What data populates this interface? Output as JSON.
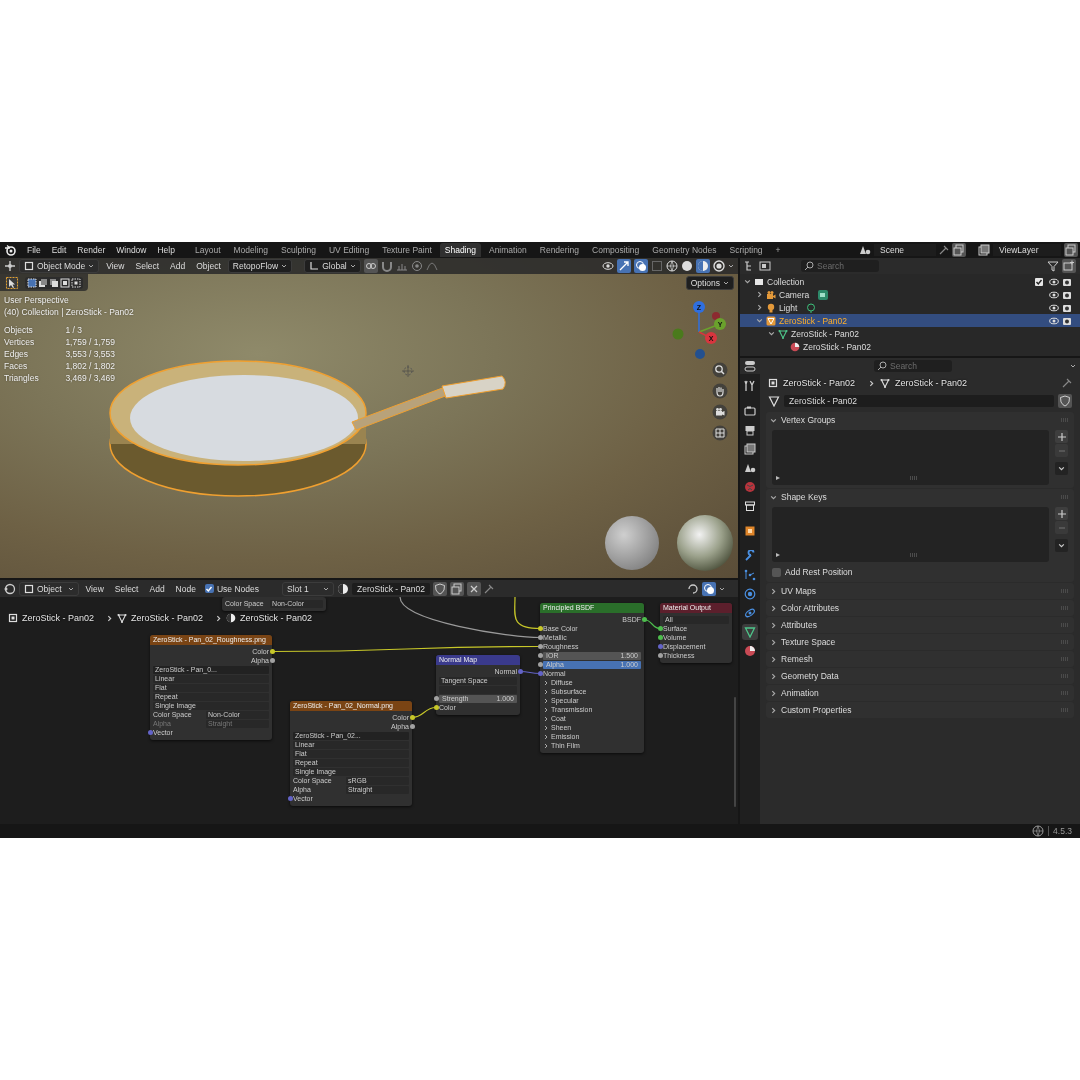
{
  "top_bar": {
    "menus": [
      "File",
      "Edit",
      "Render",
      "Window",
      "Help"
    ],
    "workspaces": [
      {
        "label": "Layout",
        "selected": false
      },
      {
        "label": "Modeling",
        "selected": false
      },
      {
        "label": "Sculpting",
        "selected": false
      },
      {
        "label": "UV Editing",
        "selected": false
      },
      {
        "label": "Texture Paint",
        "selected": false
      },
      {
        "label": "Shading",
        "selected": true
      },
      {
        "label": "Animation",
        "selected": false
      },
      {
        "label": "Rendering",
        "selected": false
      },
      {
        "label": "Compositing",
        "selected": false
      },
      {
        "label": "Geometry Nodes",
        "selected": false
      },
      {
        "label": "Scripting",
        "selected": false
      }
    ],
    "add_tab": "+",
    "scene": "Scene",
    "view_layer": "ViewLayer"
  },
  "viewport": {
    "mode": "Object Mode",
    "menus": [
      "View",
      "Select",
      "Add",
      "Object"
    ],
    "addon": "RetopoFlow",
    "orientation": "Global",
    "options": "Options",
    "view_name": "User Perspective",
    "collection": "(40) Collection | ZeroStick - Pan02",
    "stats": [
      {
        "label": "Objects",
        "value": "1 / 3"
      },
      {
        "label": "Vertices",
        "value": "1,759 / 1,759"
      },
      {
        "label": "Edges",
        "value": "3,553 / 3,553"
      },
      {
        "label": "Faces",
        "value": "1,802 / 1,802"
      },
      {
        "label": "Triangles",
        "value": "3,469 / 3,469"
      }
    ],
    "gizmo_axes": [
      "Z",
      "Y",
      "X"
    ]
  },
  "outliner": {
    "search_placeholder": "Search",
    "tree": [
      {
        "name": "Collection",
        "kind": "collection",
        "expanded": true,
        "selected": false,
        "checked": true,
        "children": [
          {
            "name": "Camera",
            "kind": "camera",
            "expanded": false,
            "selected": false
          },
          {
            "name": "Light",
            "kind": "light",
            "expanded": false,
            "selected": false
          },
          {
            "name": "ZeroStick - Pan02",
            "kind": "mesh_object",
            "expanded": true,
            "selected": true,
            "children": [
              {
                "name": "ZeroStick - Pan02",
                "kind": "mesh_data",
                "expanded": true,
                "selected": false,
                "children": [
                  {
                    "name": "ZeroStick - Pan02",
                    "kind": "material",
                    "selected": false
                  }
                ]
              }
            ]
          }
        ]
      }
    ]
  },
  "node_editor": {
    "mode": "Object",
    "menus": [
      "View",
      "Select",
      "Add",
      "Node"
    ],
    "use_nodes": {
      "label": "Use Nodes",
      "checked": true
    },
    "slot": "Slot 1",
    "material": "ZeroStick - Pan02",
    "breadcrumbs": [
      {
        "kind": "object",
        "label": "ZeroStick - Pan02"
      },
      {
        "kind": "mesh",
        "label": "ZeroStick - Pan02"
      },
      {
        "kind": "material",
        "label": "ZeroStick - Pan02"
      }
    ],
    "nodes": [
      {
        "rows": [
          {
            "kind": "property",
            "label": "Color Space",
            "value": "Non-Color",
            "disabled": false
          }
        ]
      },
      {
        "kind": "image_texture",
        "title": "ZeroStick - Pan_02_Roughness.png",
        "rows": [
          {
            "kind": "output",
            "label": "Color",
            "color": "#c7c729"
          },
          {
            "kind": "output",
            "label": "Alpha",
            "color": "#a1a1a1"
          },
          {
            "kind": "image",
            "value": "ZeroStick - Pan_0..."
          },
          {
            "kind": "dropdown",
            "value": "Linear"
          },
          {
            "kind": "dropdown",
            "value": "Flat"
          },
          {
            "kind": "dropdown",
            "value": "Repeat"
          },
          {
            "kind": "dropdown",
            "value": "Single Image"
          },
          {
            "kind": "property",
            "label": "Color Space",
            "value": "Non-Color",
            "disabled": false
          },
          {
            "kind": "property",
            "label": "Alpha",
            "value": "Straight",
            "disabled": true
          },
          {
            "kind": "input",
            "label": "Vector",
            "color": "#6363c7"
          }
        ]
      },
      {
        "kind": "image_texture",
        "title": "ZeroStick - Pan_02_Normal.png",
        "rows": [
          {
            "kind": "output",
            "label": "Color",
            "color": "#c7c729"
          },
          {
            "kind": "output",
            "label": "Alpha",
            "color": "#a1a1a1"
          },
          {
            "kind": "image",
            "value": "ZeroStick - Pan_02..."
          },
          {
            "kind": "dropdown",
            "value": "Linear"
          },
          {
            "kind": "dropdown",
            "value": "Flat"
          },
          {
            "kind": "dropdown",
            "value": "Repeat"
          },
          {
            "kind": "dropdown",
            "value": "Single Image"
          },
          {
            "kind": "property",
            "label": "Color Space",
            "value": "sRGB",
            "disabled": false
          },
          {
            "kind": "property",
            "label": "Alpha",
            "value": "Straight",
            "disabled": false
          },
          {
            "kind": "input",
            "label": "Vector",
            "color": "#6363c7"
          }
        ]
      },
      {
        "kind": "vector",
        "title": "Normal Map",
        "rows": [
          {
            "kind": "output",
            "label": "Normal",
            "color": "#6363c7"
          },
          {
            "kind": "dropdown",
            "value": "Tangent Space"
          },
          {
            "kind": "search"
          },
          {
            "kind": "slider",
            "label": "Strength",
            "value": "1.000",
            "color": "#a1a1a1",
            "selected": false
          },
          {
            "kind": "input",
            "label": "Color",
            "color": "#c7c729"
          }
        ]
      },
      {
        "kind": "shader",
        "title": "Principled BSDF",
        "rows": [
          {
            "kind": "output",
            "label": "BSDF",
            "color": "#4dbd4d"
          },
          {
            "kind": "input",
            "label": "Base Color",
            "color": "#c7c729"
          },
          {
            "kind": "input",
            "label": "Metallic",
            "color": "#a1a1a1"
          },
          {
            "kind": "input",
            "label": "Roughness",
            "color": "#a1a1a1"
          },
          {
            "kind": "slider",
            "label": "IOR",
            "value": "1.500",
            "color": "#a1a1a1",
            "selected": false
          },
          {
            "kind": "slider",
            "label": "Alpha",
            "value": "1.000",
            "color": "#a1a1a1",
            "selected": true
          },
          {
            "kind": "input",
            "label": "Normal",
            "color": "#6363c7"
          },
          {
            "kind": "panel",
            "label": "Diffuse"
          },
          {
            "kind": "panel",
            "label": "Subsurface"
          },
          {
            "kind": "panel",
            "label": "Specular"
          },
          {
            "kind": "panel",
            "label": "Transmission"
          },
          {
            "kind": "panel",
            "label": "Coat"
          },
          {
            "kind": "panel",
            "label": "Sheen"
          },
          {
            "kind": "panel",
            "label": "Emission"
          },
          {
            "kind": "panel",
            "label": "Thin Film"
          }
        ]
      },
      {
        "kind": "output",
        "title": "Material Output",
        "rows": [
          {
            "kind": "dropdown",
            "value": "All"
          },
          {
            "kind": "input",
            "label": "Surface",
            "color": "#4dbd4d"
          },
          {
            "kind": "input",
            "label": "Volume",
            "color": "#4dbd4d"
          },
          {
            "kind": "input",
            "label": "Displacement",
            "color": "#6363c7"
          },
          {
            "kind": "input",
            "label": "Thickness",
            "color": "#a1a1a1"
          }
        ]
      }
    ]
  },
  "properties": {
    "search_placeholder": "Search",
    "tabs": [
      {
        "kind": "tool",
        "selected": false
      },
      {
        "kind": "render",
        "selected": false
      },
      {
        "kind": "output",
        "selected": false
      },
      {
        "kind": "view_layer",
        "selected": false
      },
      {
        "kind": "scene",
        "selected": false
      },
      {
        "kind": "world",
        "selected": false
      },
      {
        "kind": "collection",
        "selected": false
      },
      {
        "kind": "object",
        "selected": false
      },
      {
        "kind": "modifiers",
        "selected": false
      },
      {
        "kind": "particles",
        "selected": false
      },
      {
        "kind": "physics",
        "selected": false
      },
      {
        "kind": "constraints",
        "selected": false
      },
      {
        "kind": "data",
        "selected": true
      },
      {
        "kind": "material",
        "selected": false
      }
    ],
    "breadcrumbs": [
      {
        "kind": "object",
        "label": "ZeroStick - Pan02"
      },
      {
        "kind": "mesh",
        "label": "ZeroStick - Pan02"
      }
    ],
    "data_name": "ZeroStick - Pan02",
    "panels": [
      {
        "title": "Vertex Groups",
        "expanded": true,
        "kind": "list"
      },
      {
        "title": "Shape Keys",
        "expanded": true,
        "kind": "list",
        "checkbox": {
          "label": "Add Rest Position",
          "checked": false
        }
      },
      {
        "title": "UV Maps",
        "expanded": false
      },
      {
        "title": "Color Attributes",
        "expanded": false
      },
      {
        "title": "Attributes",
        "expanded": false
      },
      {
        "title": "Texture Space",
        "expanded": false
      },
      {
        "title": "Remesh",
        "expanded": false
      },
      {
        "title": "Geometry Data",
        "expanded": false
      },
      {
        "title": "Animation",
        "expanded": false
      },
      {
        "title": "Custom Properties",
        "expanded": false
      }
    ]
  },
  "status_bar": {
    "version": "4.5.3"
  }
}
